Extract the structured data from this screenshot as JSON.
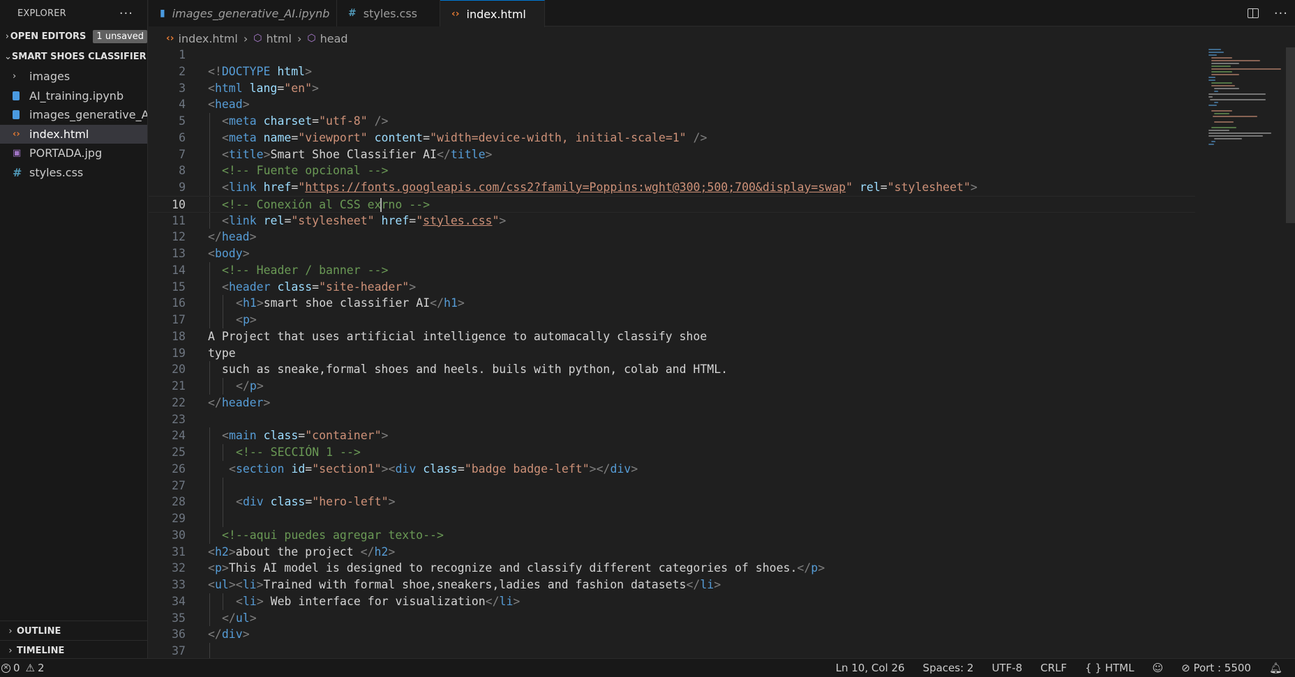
{
  "explorer": {
    "title": "EXPLORER",
    "more": "···",
    "open_editors": {
      "label": "OPEN EDITORS",
      "badge": "1 unsaved"
    },
    "project": {
      "label": "SMART SHOES CLASSIFIER..."
    },
    "items": [
      {
        "label": "images"
      },
      {
        "label": "AI_training.ipynb"
      },
      {
        "label": "images_generative_AI..."
      },
      {
        "label": "index.html"
      },
      {
        "label": "PORTADA.jpg"
      },
      {
        "label": "styles.css"
      }
    ],
    "outline": "OUTLINE",
    "timeline": "TIMELINE"
  },
  "tabs": [
    {
      "label": "images_generative_AI.ipynb"
    },
    {
      "label": "styles.css"
    },
    {
      "label": "index.html"
    }
  ],
  "breadcrumb": [
    "index.html",
    "html",
    "head"
  ],
  "editor": {
    "current_line": 10,
    "lines": [
      "1",
      "2",
      "3",
      "4",
      "5",
      "6",
      "7",
      "8",
      "9",
      "10",
      "11",
      "12",
      "13",
      "14",
      "15",
      "16",
      "17",
      "18",
      "19",
      "20",
      "21",
      "22",
      "23",
      "24",
      "25",
      "26",
      "27",
      "28",
      "29",
      "30",
      "31",
      "32",
      "33",
      "34",
      "35",
      "36",
      "37"
    ],
    "code": {
      "l2": [
        "<!",
        "DOCTYPE",
        " html",
        ">"
      ],
      "l3": [
        "<",
        "html",
        " lang",
        "=",
        "\"en\"",
        ">"
      ],
      "l4": [
        "<",
        "head",
        ">"
      ],
      "l5": [
        "<",
        "meta",
        " charset",
        "=",
        "\"utf-8\"",
        " />"
      ],
      "l6": [
        "<",
        "meta",
        " name",
        "=",
        "\"viewport\"",
        " content",
        "=",
        "\"width=device-width, initial-scale=1\"",
        " />"
      ],
      "l7": [
        "<",
        "title",
        ">",
        "Smart Shoe Classifier AI",
        "</",
        "title",
        ">"
      ],
      "l8": "<!-- Fuente opcional -->",
      "l9": [
        "<",
        "link",
        " href",
        "=",
        "\"",
        "https://fonts.googleapis.com/css2?family=Poppins:wght@300;500;700&display=swap",
        "\"",
        " rel",
        "=",
        "\"stylesheet\"",
        ">"
      ],
      "l10a": "<!-- Conexión al CSS ex",
      "l10b": "rno -->",
      "l11": [
        "<",
        "link",
        " rel",
        "=",
        "\"stylesheet\"",
        " href",
        "=",
        "\"",
        "styles.css",
        "\"",
        ">"
      ],
      "l12": [
        "</",
        "head",
        ">"
      ],
      "l13": [
        "<",
        "body",
        ">"
      ],
      "l14": "<!-- Header / banner -->",
      "l15": [
        "<",
        "header",
        " class",
        "=",
        "\"site-header\"",
        ">"
      ],
      "l16": [
        "<",
        "h1",
        ">",
        "smart shoe classifier AI",
        "</",
        "h1",
        ">"
      ],
      "l17": [
        "<",
        "p",
        ">"
      ],
      "l18": "A Project that uses artificial intelligence to automacally classify shoe",
      "l19": "type",
      "l20": " such as sneake,formal shoes and heels. buils with python, colab and HTML.",
      "l21": [
        "</",
        "p",
        ">"
      ],
      "l22": [
        "</",
        "header",
        ">"
      ],
      "l24": [
        "<",
        "main",
        " class",
        "=",
        "\"container\"",
        ">"
      ],
      "l25": "<!-- SECCIÓN 1 -->",
      "l26": [
        "<",
        "section",
        " id",
        "=",
        "\"section1\"",
        ">",
        "<",
        "div",
        " class",
        "=",
        "\"badge badge-left\"",
        ">",
        "</",
        "div",
        ">"
      ],
      "l28": [
        "<",
        "div",
        " class",
        "=",
        "\"hero-left\"",
        ">"
      ],
      "l30": "<!--aqui puedes agregar texto-->",
      "l31": [
        "<",
        "h2",
        ">",
        "about the project ",
        "</",
        "h2",
        ">"
      ],
      "l32": [
        "<",
        "p",
        ">",
        "This AI model is designed to recognize and classify different categories of shoes.",
        "</",
        "p",
        ">"
      ],
      "l33": [
        "<",
        "ul",
        ">",
        "<",
        "li",
        ">",
        "Trained with formal shoe,sneakers,ladies and fashion datasets",
        "</",
        "li",
        ">"
      ],
      "l34": [
        "<",
        "li",
        ">",
        " Web interface for visualization",
        "</",
        "li",
        ">"
      ],
      "l35": [
        "</",
        "ul",
        ">"
      ],
      "l36": [
        "</",
        "div",
        ">"
      ]
    }
  },
  "status": {
    "errors": "0",
    "warnings": "2",
    "position": "Ln 10, Col 26",
    "spaces": "Spaces: 2",
    "encoding": "UTF-8",
    "eol": "CRLF",
    "language": "HTML",
    "port": "Port : 5500"
  },
  "colors": {
    "accent": "#0078d4",
    "tag": "#569cd6",
    "attribute": "#9cdcfe",
    "string": "#ce9178",
    "comment": "#6a9955"
  }
}
